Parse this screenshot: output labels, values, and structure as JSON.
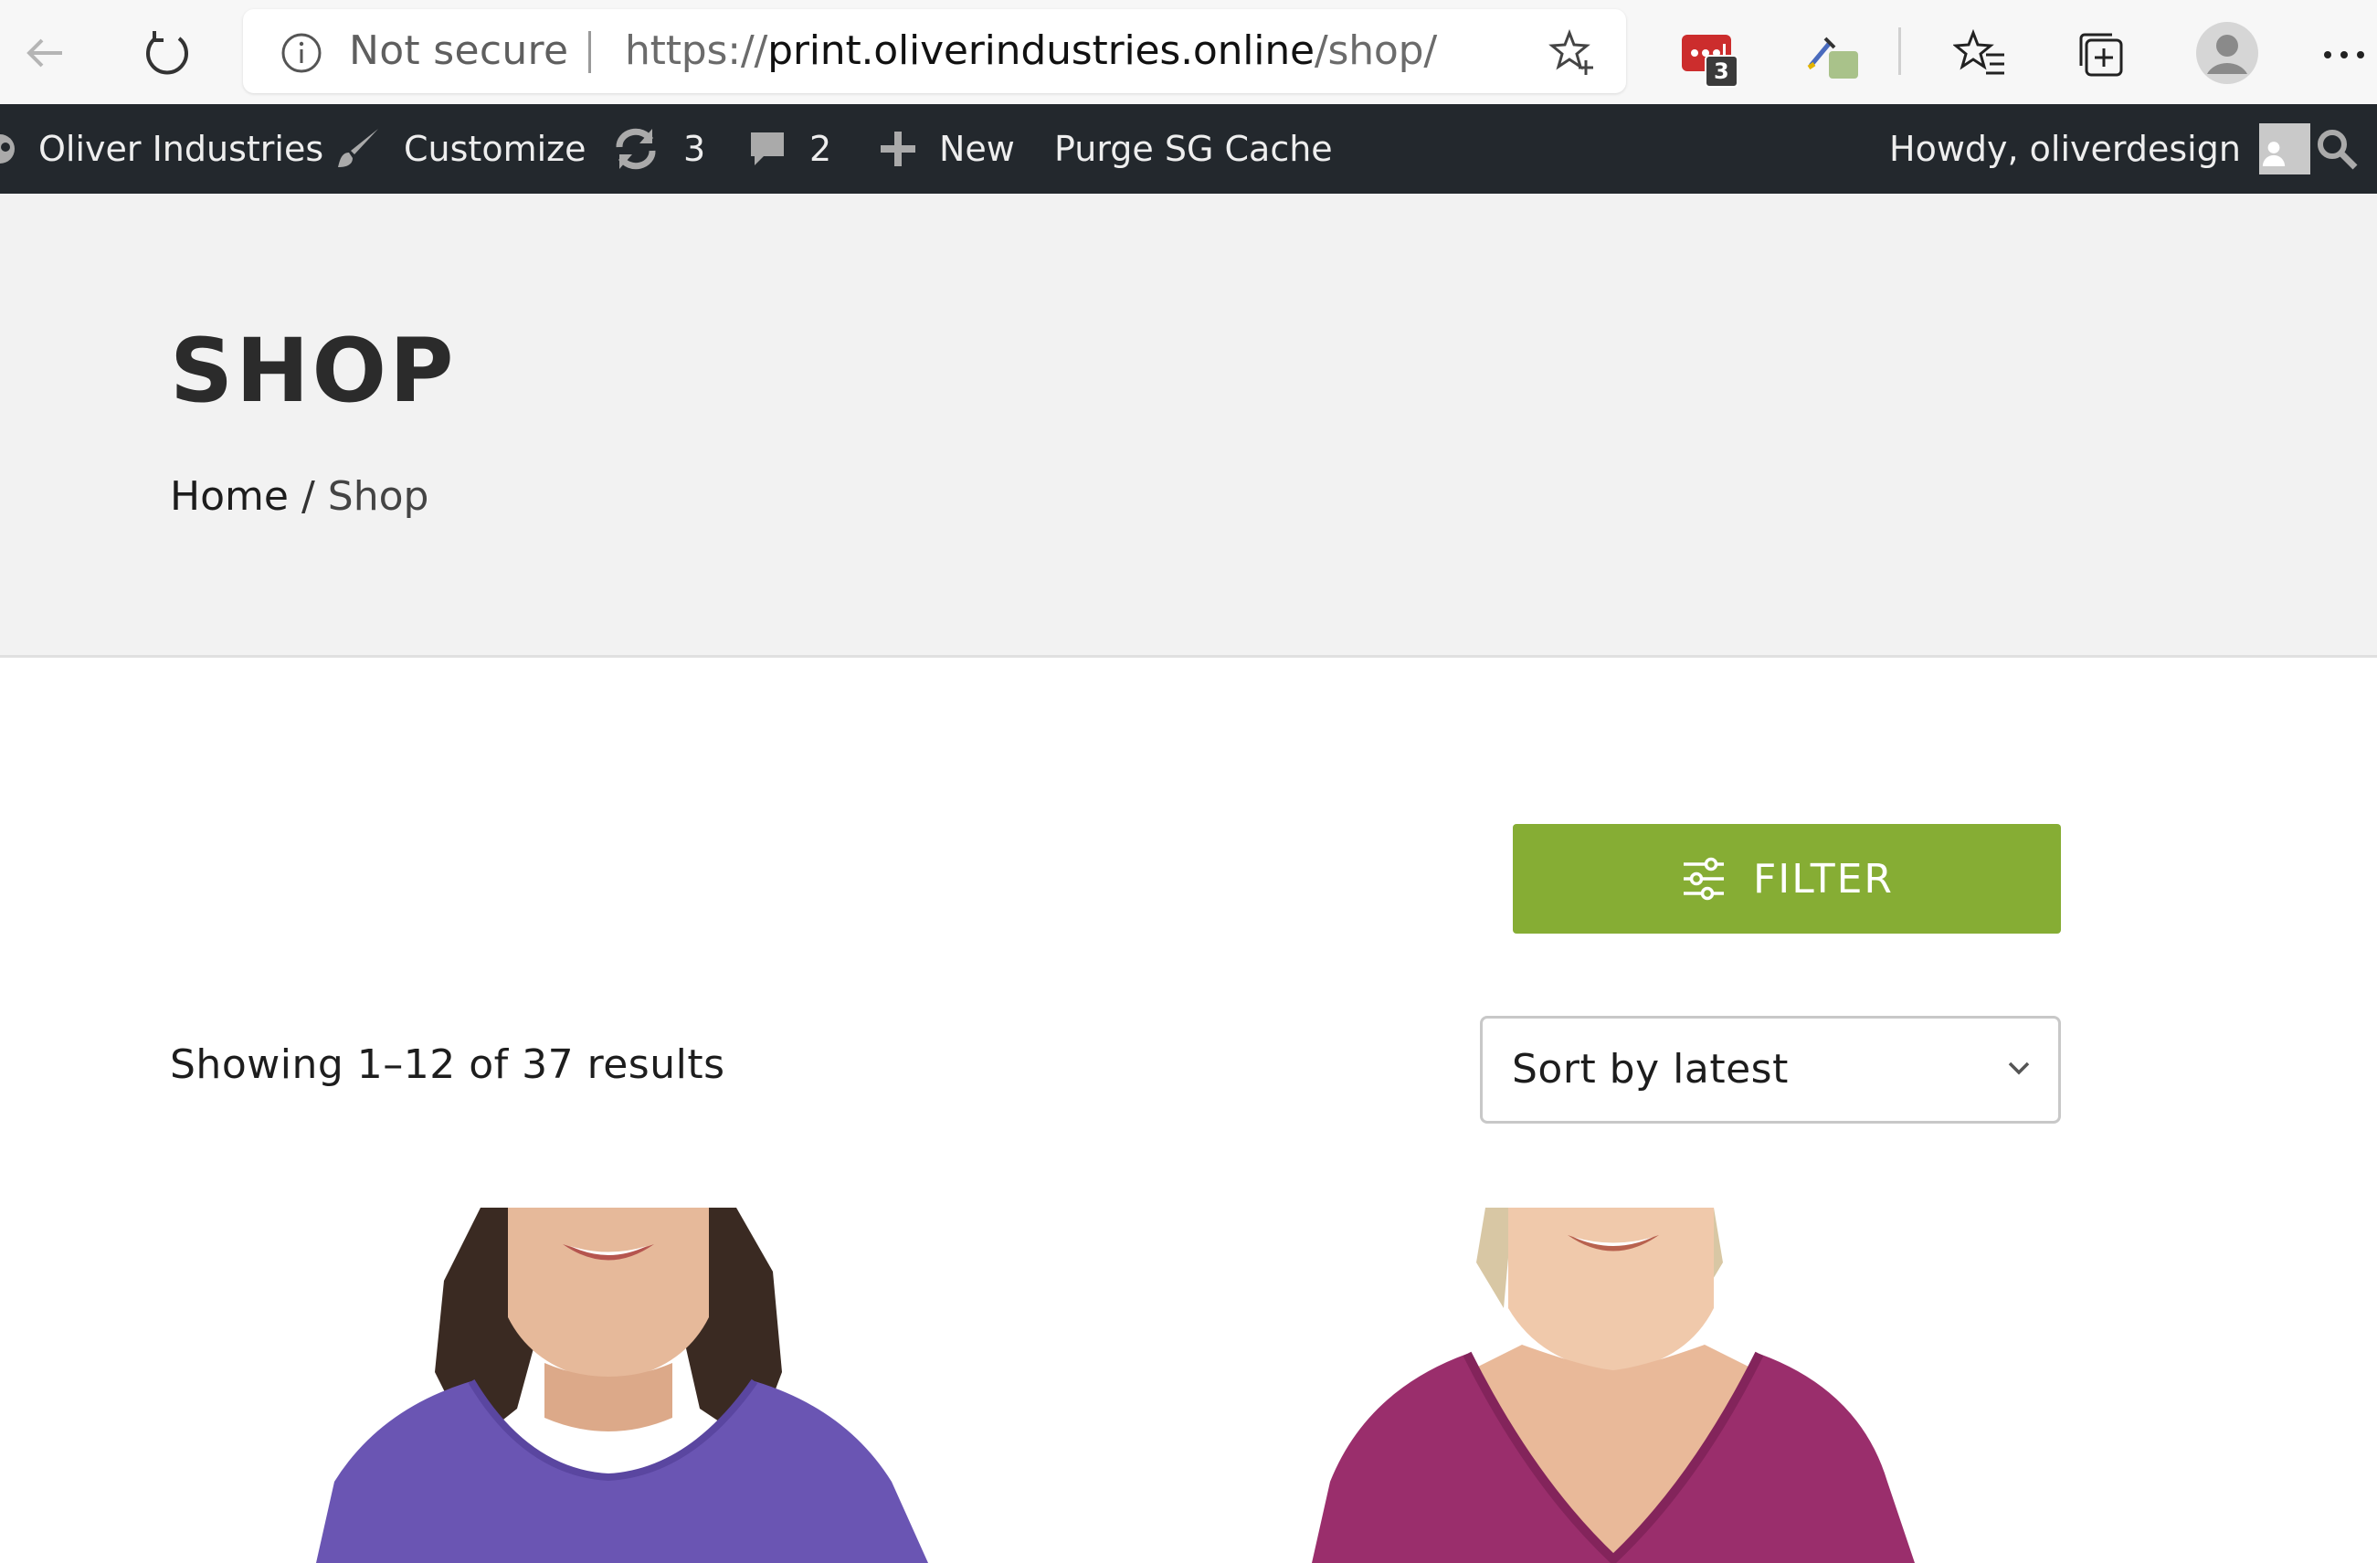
{
  "browser": {
    "not_secure_label": "Not secure",
    "url_scheme": "https://",
    "url_host": "print.oliverindustries.online",
    "url_path": "/shop/",
    "extension_badge": "3"
  },
  "admin_bar": {
    "site_name": "Oliver Industries",
    "customize_label": "Customize",
    "updates_count": "3",
    "comments_count": "2",
    "new_label": "New",
    "purge_label": "Purge SG Cache",
    "howdy_label": "Howdy, oliverdesign"
  },
  "page": {
    "title": "SHOP",
    "breadcrumb": {
      "home": "Home",
      "separator": "/",
      "current": "Shop"
    }
  },
  "shop": {
    "filter_label": "FILTER",
    "results_text": "Showing 1–12 of 37 results",
    "sort_selected": "Sort by latest"
  },
  "colors": {
    "admin_bar_bg": "#23282d",
    "hero_bg": "#f2f2f2",
    "filter_green": "#86ad34",
    "product_1_shirt": "#6a55b3",
    "product_2_shirt": "#9a2e6c"
  },
  "icons": [
    "back-arrow-icon",
    "refresh-icon",
    "info-icon",
    "star-add-icon",
    "extension-lastpass-icon",
    "extension-picker-icon",
    "favorites-icon",
    "collections-icon",
    "profile-icon",
    "more-icon",
    "wordpress-icon",
    "paintbrush-icon",
    "updates-icon",
    "comment-icon",
    "plus-icon",
    "user-avatar-icon",
    "search-icon",
    "sliders-icon",
    "chevron-down-icon"
  ]
}
